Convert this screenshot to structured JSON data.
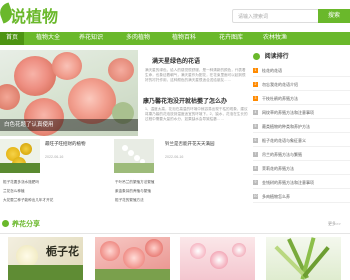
{
  "header": {
    "logo_text": "说植物",
    "search_placeholder": "请输入搜索词",
    "search_button": "搜索"
  },
  "nav": {
    "items": [
      "首页",
      "植物大全",
      "养花知识",
      "多肉植物",
      "植物百科",
      "花卉图库",
      "农林牧渔"
    ]
  },
  "slider": {
    "caption": "白色花题了认真使用"
  },
  "articles": [
    {
      "title": "满天星绿色的花语",
      "text": "满天星的绿色，给人的感觉很舒服，是一种清新的颜色，代表着生命，也象征着朝气，满天星作为配花，在花束里面可以起到很好的衬托作用，这种颜色的满天星很适合送给朋友……"
    },
    {
      "title": "康乃馨花泡没开就枯萎了怎么办",
      "text": "1、温度太高，花泡在高温的环境中就容易出现干枯的现象，建议将康乃馨的花泡放到温度适宜的环境下。2、缺水，花泡在生长的过程中需要大量的水分，如果缺水会导致枯萎……"
    }
  ],
  "cards": [
    {
      "title": "最旺子旺招财的植物",
      "date": "2022-06-16"
    },
    {
      "title": "铃兰是否能开花天天满园",
      "date": "2022-06-16"
    }
  ],
  "list_left": [
    "栀子花要多浇水施肥吗",
    "兰花怎么种植",
    "大花蕙兰种子能种出几年才开花"
  ],
  "list_right": [
    "千叶吊兰的繁殖方法繁殖",
    "紫金象耳的养殖与繁殖",
    "栀子花的繁殖方法"
  ],
  "rank": {
    "title": "阅读排行",
    "items": [
      "桂花的花语",
      "勿忘我花的花语介绍",
      "干枝杜鹃的养殖方法",
      "网纹草的养殖方法和注意事项",
      "蕨类植物的种类和养护方法",
      "栀子花的花语与象征意义",
      "吊兰的养殖方法与繁殖",
      "茉莉花的养殖方法",
      "金钱树的养殖方法和注意事项",
      "多肉植物怎么养"
    ]
  },
  "section": {
    "title": "养花分享",
    "more": "更多>>"
  },
  "gallery_label": "栀子花",
  "colors": {
    "brand": "#6ab82b",
    "nav_active": "#4d9413",
    "rank_top": "#ff8a00"
  }
}
